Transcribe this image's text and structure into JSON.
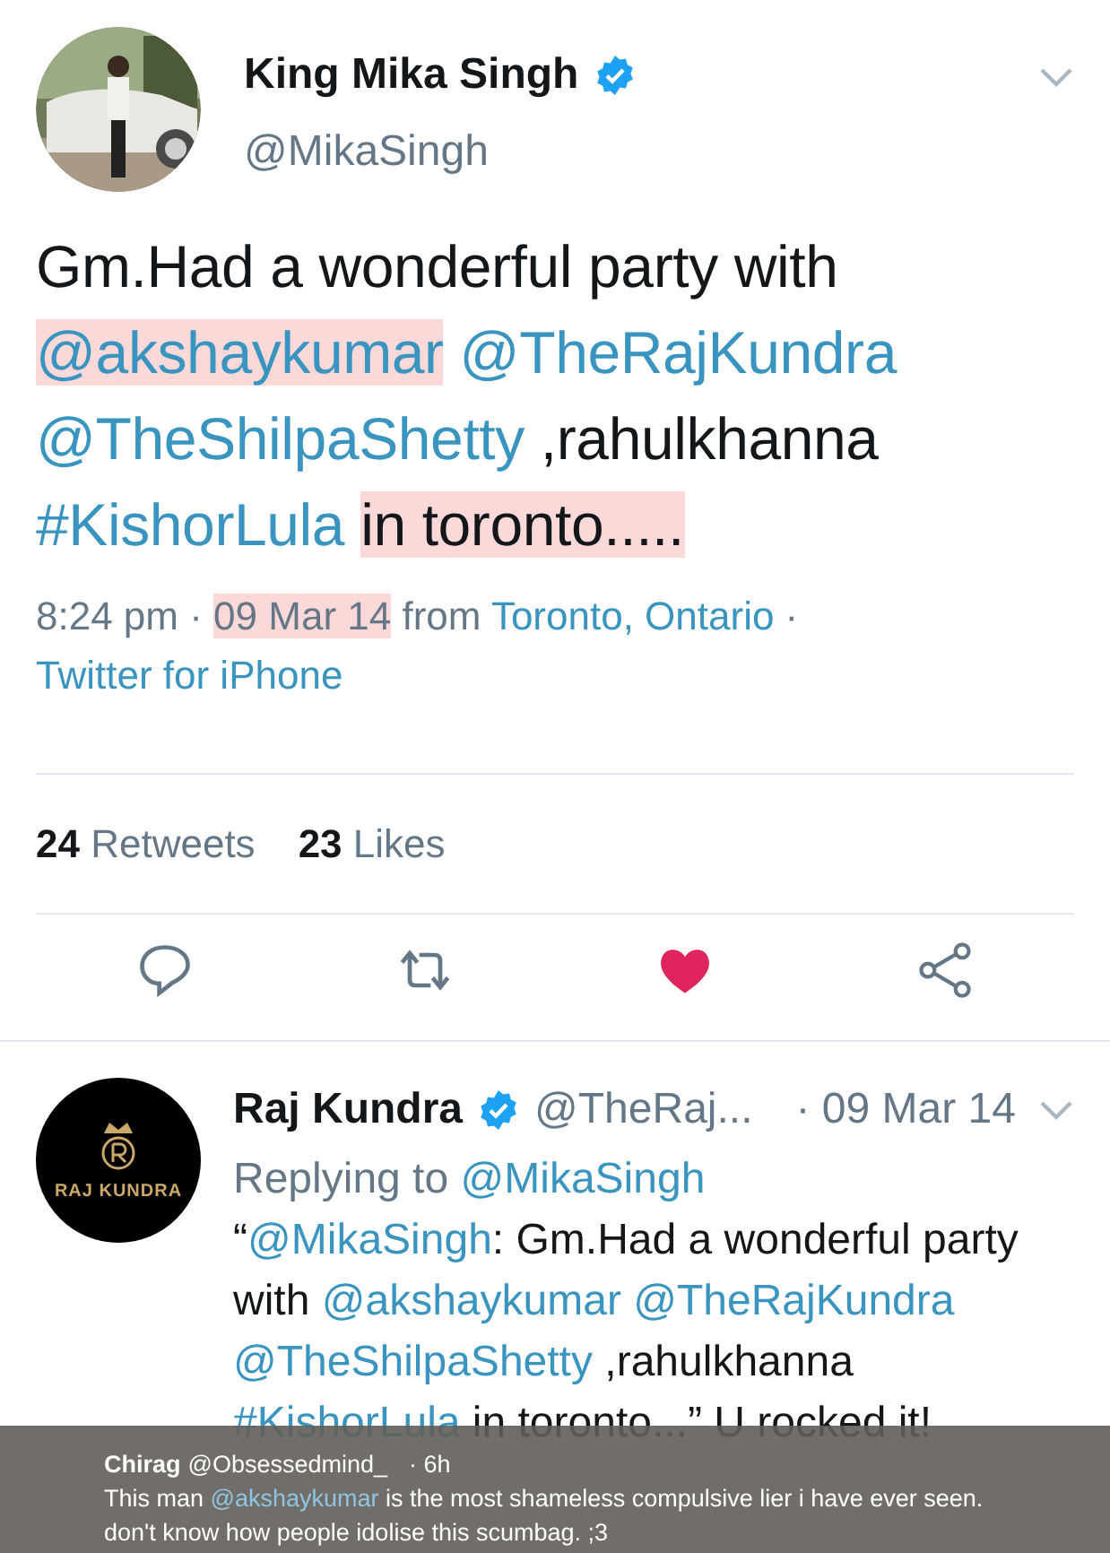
{
  "tweet": {
    "name": "King Mika Singh",
    "verified": true,
    "handle": "@MikaSingh",
    "text": [
      {
        "kind": "text",
        "text": "Gm.Had a wonderful party with ",
        "highlighted": false
      },
      {
        "kind": "link",
        "text": "@akshaykumar",
        "highlighted": true
      },
      {
        "kind": "link",
        "text": " @TheRajKundra",
        "highlighted": false
      },
      {
        "kind": "link",
        "text": " @TheShilpaShetty",
        "highlighted": false
      },
      {
        "kind": "text",
        "text": " ,rahulkhanna ",
        "highlighted": false
      },
      {
        "kind": "link",
        "text": "#KishorLula ",
        "highlighted": false
      },
      {
        "kind": "text",
        "text": "in toronto.....",
        "highlighted": true
      }
    ],
    "meta": [
      {
        "kind": "text",
        "text": "8:24 pm · ",
        "highlighted": false
      },
      {
        "kind": "text",
        "text": "09 Mar 14",
        "highlighted": true
      },
      {
        "kind": "text",
        "text": " from ",
        "highlighted": false
      },
      {
        "kind": "link",
        "text": "Toronto, Ontario",
        "highlighted": false
      },
      {
        "kind": "text",
        "text": " · ",
        "highlighted": false
      },
      {
        "kind": "link",
        "text": "Twitter for iPhone",
        "highlighted": false
      }
    ],
    "stats": [
      {
        "count": "24",
        "label": "Retweets"
      },
      {
        "count": "23",
        "label": "Likes"
      }
    ],
    "liked": true
  },
  "reply": {
    "logo_text": "RAJ KUNDRA",
    "name": "Raj Kundra",
    "verified": true,
    "handle": "@TheRaj...",
    "time": "· 09 Mar 14",
    "replying_to": "Replying to",
    "replying_handle": "@MikaSingh",
    "text": [
      {
        "kind": "text",
        "text": "“"
      },
      {
        "kind": "link",
        "text": "@MikaSingh"
      },
      {
        "kind": "text",
        "text": ": Gm.Had a wonderful party with "
      },
      {
        "kind": "link",
        "text": "@akshaykumar"
      },
      {
        "kind": "link",
        "text": " @TheRajKundra"
      },
      {
        "kind": "link",
        "text": " @TheShilpaShetty"
      },
      {
        "kind": "text",
        "text": " ,rahulkhanna "
      },
      {
        "kind": "link",
        "text": "#KishorLula"
      },
      {
        "kind": "text",
        "text": " in toronto...” U rocked it!"
      }
    ]
  },
  "overlay": {
    "name": "Chirag",
    "handle": "@Obsessedmind_",
    "time": "· 6h",
    "text": [
      {
        "kind": "text",
        "text": "This man "
      },
      {
        "kind": "link",
        "text": "@akshaykumar"
      },
      {
        "kind": "text",
        "text": " is the most shameless compulsive lier i have ever seen.\ndon't know how people idolise this scumbag. ;3"
      }
    ]
  }
}
